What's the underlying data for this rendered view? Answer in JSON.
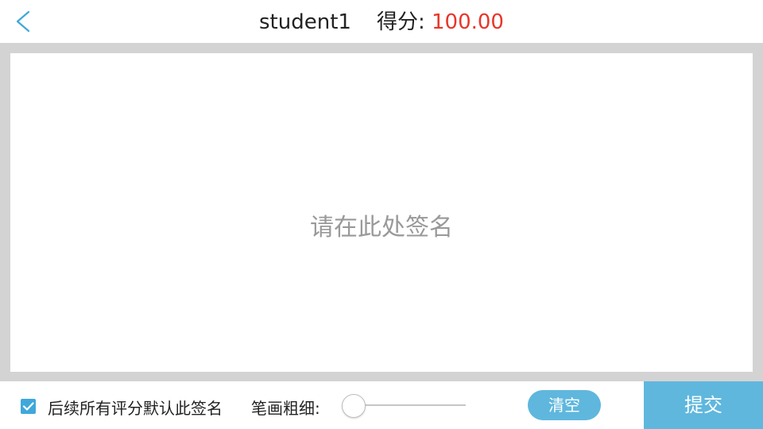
{
  "header": {
    "back_icon": "chevron-left-icon",
    "student_name": "student1",
    "score_label": "得分:",
    "score_value": "100.00"
  },
  "canvas": {
    "placeholder": "请在此处签名"
  },
  "footer": {
    "default_signature": {
      "checked": true,
      "label": "后续所有评分默认此签名"
    },
    "stroke_width": {
      "label": "笔画粗细:",
      "level": 0
    },
    "clear_label": "清空",
    "submit_label": "提交"
  },
  "colors": {
    "accent": "#3fa8da",
    "button": "#5fb7dd",
    "score": "#e8362a",
    "frame": "#d3d3d3",
    "placeholder": "#999999"
  }
}
